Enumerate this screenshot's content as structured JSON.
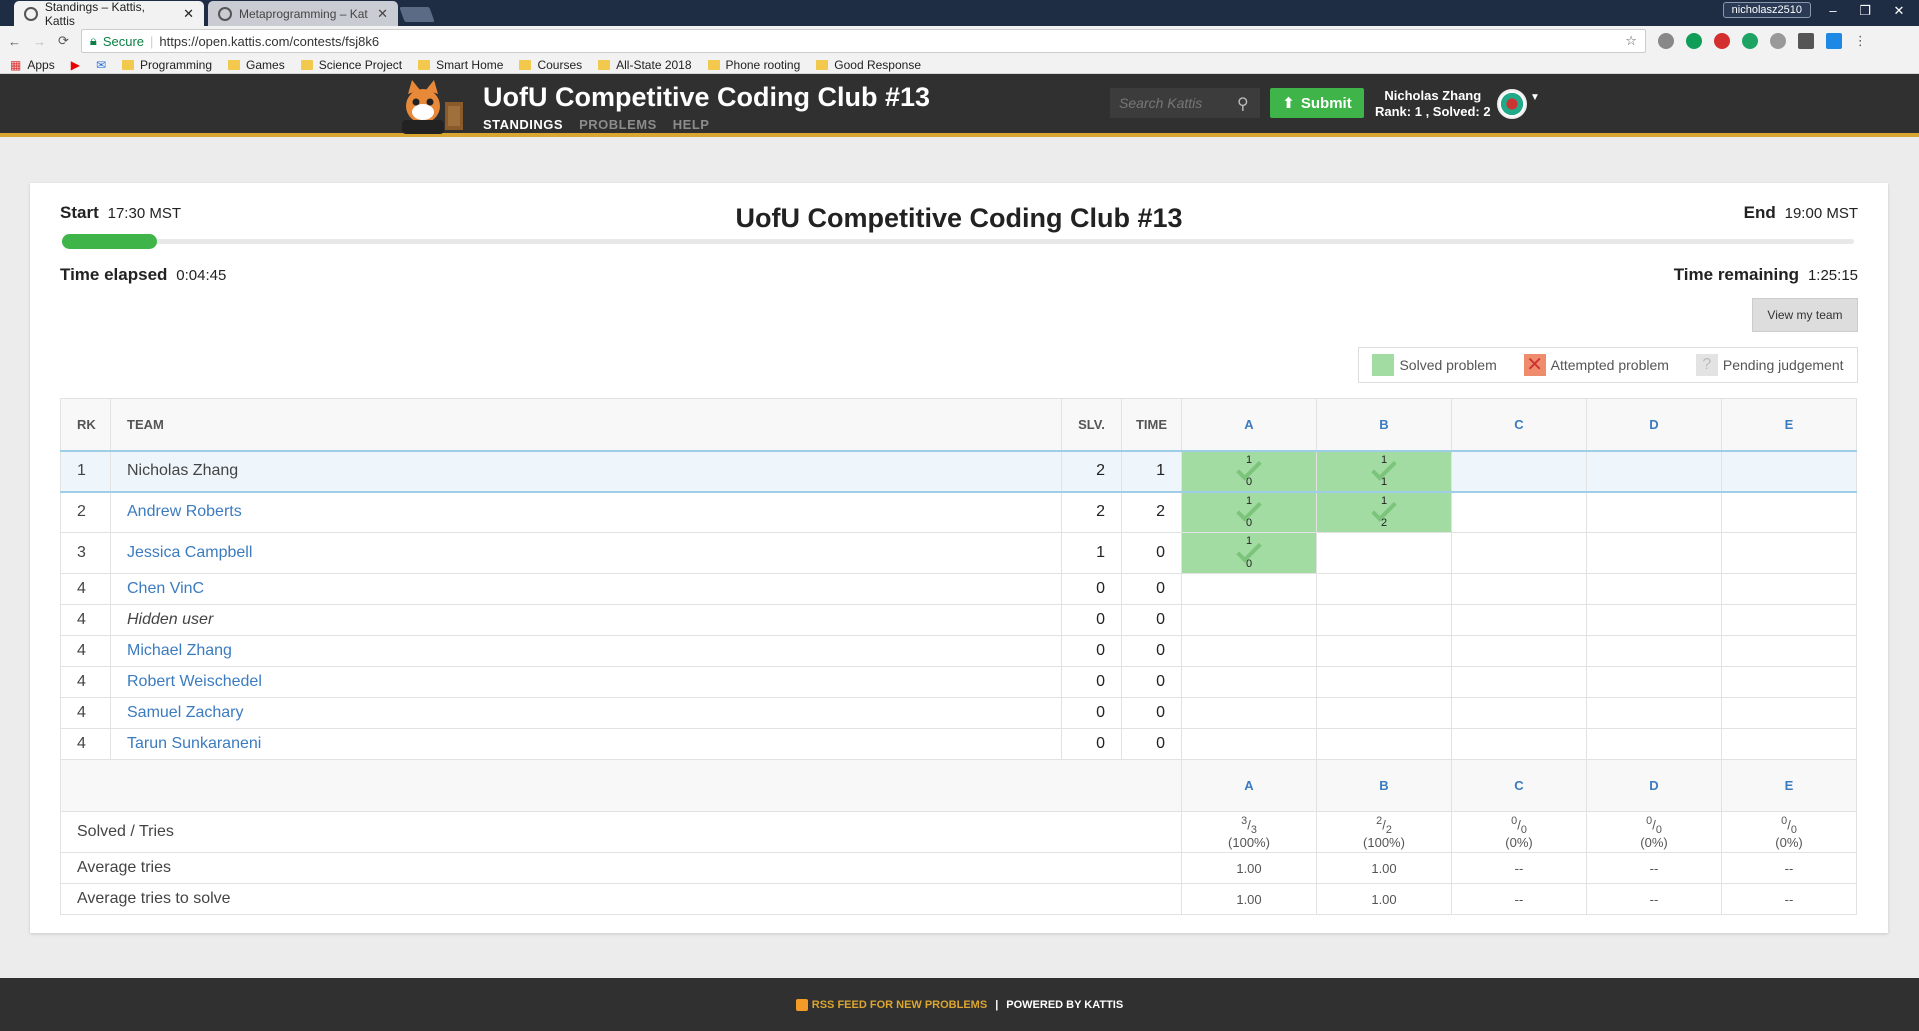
{
  "browser": {
    "tabs": [
      {
        "title": "Standings – Kattis, Kattis",
        "active": true
      },
      {
        "title": "Metaprogramming – Kat",
        "active": false
      }
    ],
    "profile": "nicholasz2510",
    "secure_label": "Secure",
    "url": "https://open.kattis.com/contests/fsj8k6",
    "bookmarks": [
      "Apps",
      "Programming",
      "Games",
      "Science Project",
      "Smart Home",
      "Courses",
      "All-State 2018",
      "Phone rooting",
      "Good Response"
    ]
  },
  "header": {
    "title": "UofU Competitive Coding Club #13",
    "nav": [
      "STANDINGS",
      "PROBLEMS",
      "HELP"
    ],
    "search_placeholder": "Search Kattis",
    "submit_label": "Submit",
    "user_name": "Nicholas Zhang",
    "user_stats": "Rank: 1 , Solved: 2"
  },
  "contest": {
    "start_label": "Start",
    "start_time": "17:30 MST",
    "end_label": "End",
    "end_time": "19:00 MST",
    "title": "UofU Competitive Coding Club #13",
    "elapsed_label": "Time elapsed",
    "elapsed": "0:04:45",
    "remaining_label": "Time remaining",
    "remaining": "1:25:15",
    "progress_fraction": 0.053,
    "view_team_label": "View my team"
  },
  "legend": {
    "solved": "Solved problem",
    "attempted": "Attempted problem",
    "pending": "Pending judgement"
  },
  "table": {
    "headers": {
      "rank": "RK",
      "team": "TEAM",
      "solved": "SLV.",
      "time": "TIME"
    },
    "problems": [
      "A",
      "B",
      "C",
      "D",
      "E"
    ],
    "rows": [
      {
        "rank": "1",
        "team": "Nicholas Zhang",
        "solved": "2",
        "time": "1",
        "cells": [
          [
            "1",
            "0"
          ],
          [
            "1",
            "1"
          ],
          null,
          null,
          null
        ]
      },
      {
        "rank": "2",
        "team": "Andrew Roberts",
        "solved": "2",
        "time": "2",
        "cells": [
          [
            "1",
            "0"
          ],
          [
            "1",
            "2"
          ],
          null,
          null,
          null
        ]
      },
      {
        "rank": "3",
        "team": "Jessica Campbell",
        "solved": "1",
        "time": "0",
        "cells": [
          [
            "1",
            "0"
          ],
          null,
          null,
          null,
          null
        ]
      },
      {
        "rank": "4",
        "team": "Chen VinC",
        "solved": "0",
        "time": "0"
      },
      {
        "rank": "4",
        "team": "Hidden user",
        "solved": "0",
        "time": "0"
      },
      {
        "rank": "4",
        "team": "Michael Zhang",
        "solved": "0",
        "time": "0"
      },
      {
        "rank": "4",
        "team": "Robert Weischedel",
        "solved": "0",
        "time": "0"
      },
      {
        "rank": "4",
        "team": "Samuel Zachary",
        "solved": "0",
        "time": "0"
      },
      {
        "rank": "4",
        "team": "Tarun Sunkaraneni",
        "solved": "0",
        "time": "0"
      }
    ],
    "summary": {
      "solved_tries_label": "Solved / Tries",
      "solved_tries": [
        {
          "num": "3",
          "den": "3",
          "pct": "(100%)"
        },
        {
          "num": "2",
          "den": "2",
          "pct": "(100%)"
        },
        {
          "num": "0",
          "den": "0",
          "pct": "(0%)"
        },
        {
          "num": "0",
          "den": "0",
          "pct": "(0%)"
        },
        {
          "num": "0",
          "den": "0",
          "pct": "(0%)"
        }
      ],
      "avg_tries_label": "Average tries",
      "avg_tries": [
        "1.00",
        "1.00",
        "--",
        "--",
        "--"
      ],
      "avg_tries_solve_label": "Average tries to solve",
      "avg_tries_solve": [
        "1.00",
        "1.00",
        "--",
        "--",
        "--"
      ]
    }
  },
  "footer": {
    "rss": "RSS FEED FOR NEW PROBLEMS",
    "sep": "|",
    "powered": "POWERED BY KATTIS"
  }
}
